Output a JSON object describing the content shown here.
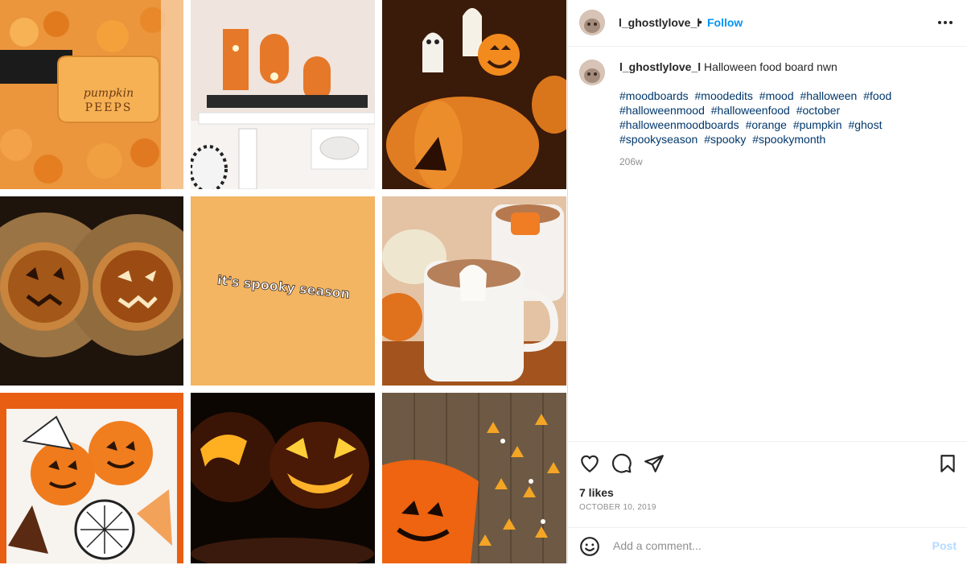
{
  "post": {
    "username": "l_ghostlylove_l",
    "separator": "•",
    "follow_label": "Follow",
    "caption_username": "l_ghostlylove_l",
    "caption_text": "Halloween food board nwn",
    "hashtags": [
      "#moodboards",
      "#moodedits",
      "#mood",
      "#halloween",
      "#food",
      "#halloweenmood",
      "#halloweenfood",
      "#october",
      "#halloweenmoodboards",
      "#orange",
      "#pumpkin",
      "#ghost",
      "#spookyseason",
      "#spooky",
      "#spookymonth"
    ],
    "caption_age": "206w",
    "likes": "7 likes",
    "date": "OCTOBER 10, 2019",
    "comment_placeholder": "Add a comment...",
    "post_label": "Post"
  },
  "media": {
    "tiles": [
      {
        "name": "pumpkin-peeps-jar",
        "label_line1": "pumpkin",
        "label_line2": "PEEPS"
      },
      {
        "name": "boo-mantel"
      },
      {
        "name": "ghost-lollipops-pumpkin"
      },
      {
        "name": "pumpkin-pies"
      },
      {
        "name": "spooky-season-text",
        "text": "it's spooky season"
      },
      {
        "name": "ghost-hot-cocoa"
      },
      {
        "name": "halloween-cookies"
      },
      {
        "name": "glowing-jack-o-lanterns"
      },
      {
        "name": "candy-corn-bucket"
      }
    ]
  },
  "icons": [
    "more-icon",
    "heart-icon",
    "comment-icon",
    "share-icon",
    "bookmark-icon",
    "emoji-icon"
  ],
  "colors": {
    "follow": "#0095f6",
    "hashtag": "#00376b",
    "muted": "#8e8e8e",
    "post_disabled": "#b3dbff"
  }
}
